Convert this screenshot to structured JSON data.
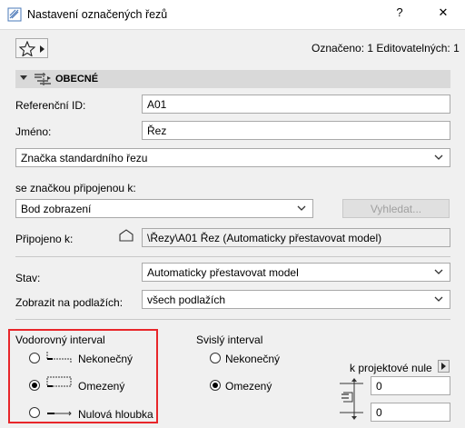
{
  "window": {
    "title": "Nastavení označených řezů",
    "help_label": "?",
    "close_label": "✕"
  },
  "toolbar": {
    "selection_info": "Označeno: 1 Editovatelných: 1"
  },
  "section": {
    "title": "OBECNÉ"
  },
  "fields": {
    "ref_id_label": "Referenční ID:",
    "ref_id_value": "A01",
    "name_label": "Jméno:",
    "name_value": "Řez",
    "marker_type_value": "Značka standardního řezu",
    "linked_marker_label": "se značkou připojenou k:",
    "linked_marker_value": "Bod zobrazení",
    "browse_label": "Vyhledat...",
    "linked_to_label": "Připojeno k:",
    "linked_to_value": "\\Řezy\\A01 Řez (Automaticky přestavovat model)",
    "status_label": "Stav:",
    "status_value": "Automaticky přestavovat model",
    "show_on_floors_label": "Zobrazit na podlažích:",
    "show_on_floors_value": "všech podlažích"
  },
  "horizontal_range": {
    "title": "Vodorovný interval",
    "options": [
      {
        "label": "Nekonečný",
        "selected": false
      },
      {
        "label": "Omezený",
        "selected": true
      },
      {
        "label": "Nulová hloubka",
        "selected": false
      }
    ]
  },
  "vertical_range": {
    "title": "Svislý interval",
    "options": [
      {
        "label": "Nekonečný",
        "selected": false
      },
      {
        "label": "Omezený",
        "selected": true
      }
    ],
    "reference_label": "k projektové nule",
    "top_value": "0",
    "bottom_value": "0"
  },
  "colors": {
    "highlight_border": "#e8262a",
    "section_header_bg": "#d9d9d9"
  }
}
